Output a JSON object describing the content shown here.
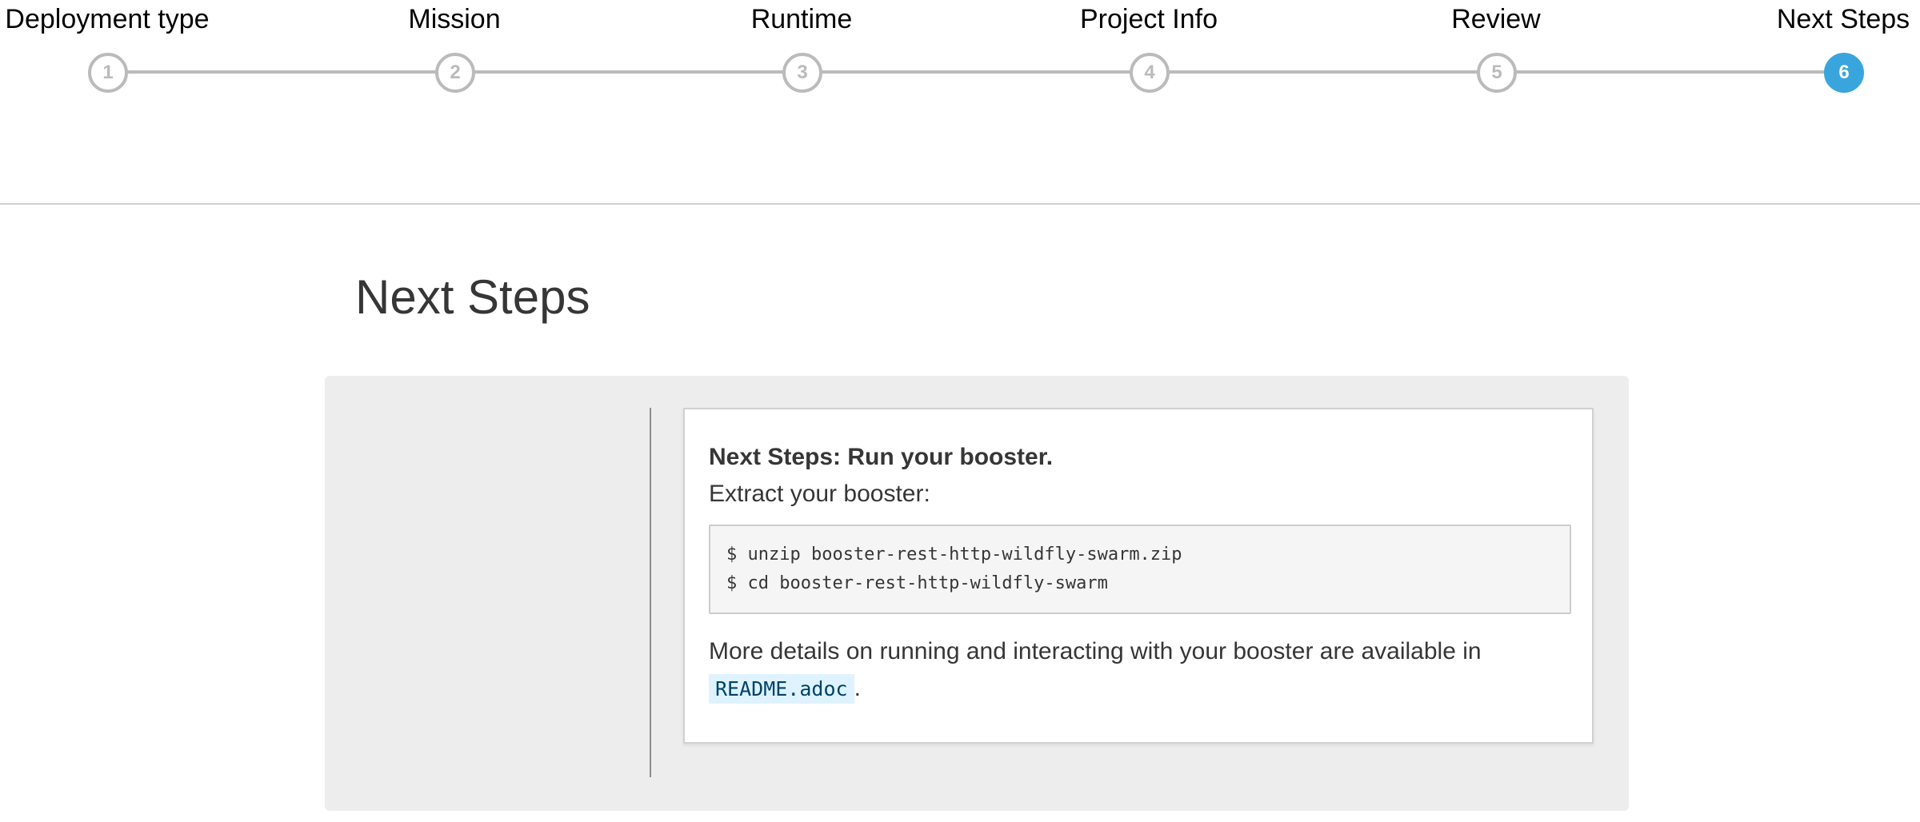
{
  "wizard": {
    "steps": [
      {
        "label": "Deployment type",
        "number": "1",
        "active": false
      },
      {
        "label": "Mission",
        "number": "2",
        "active": false
      },
      {
        "label": "Runtime",
        "number": "3",
        "active": false
      },
      {
        "label": "Project Info",
        "number": "4",
        "active": false
      },
      {
        "label": "Review",
        "number": "5",
        "active": false
      },
      {
        "label": "Next Steps",
        "number": "6",
        "active": true
      }
    ]
  },
  "page": {
    "title": "Next Steps"
  },
  "card": {
    "title": "Next Steps: Run your booster.",
    "subtitle": "Extract your booster:",
    "code_lines": [
      "$ unzip booster-rest-http-wildfly-swarm.zip",
      "$ cd booster-rest-http-wildfly-swarm"
    ],
    "details_text": "More details on running and interacting with your booster are available in",
    "readme_file": "README.adoc",
    "details_suffix": "."
  },
  "colors": {
    "active_step": "#39a5dc",
    "inactive_step": "#bbbbbb",
    "panel_bg": "#ededed",
    "inline_code_bg": "#def3ff"
  }
}
